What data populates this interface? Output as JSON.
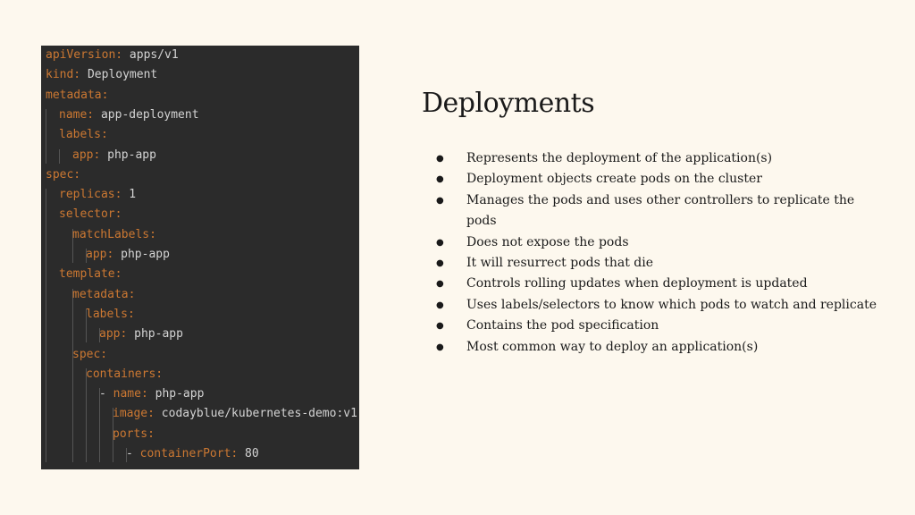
{
  "code": {
    "lines": [
      {
        "key": "apiVersion:",
        "val": " apps/v1"
      },
      {
        "key": "kind:",
        "val": " Deployment"
      },
      {
        "key": "metadata:",
        "val": ""
      },
      {
        "key": "name:",
        "val": " app-deployment"
      },
      {
        "key": "labels:",
        "val": ""
      },
      {
        "key": "app:",
        "val": " php-app"
      },
      {
        "key": "spec:",
        "val": ""
      },
      {
        "key": "replicas:",
        "val": " 1"
      },
      {
        "key": "selector:",
        "val": ""
      },
      {
        "key": "matchLabels:",
        "val": ""
      },
      {
        "key": "app:",
        "val": " php-app"
      },
      {
        "key": "template:",
        "val": ""
      },
      {
        "key": "metadata:",
        "val": ""
      },
      {
        "key": "labels:",
        "val": ""
      },
      {
        "key": "app:",
        "val": " php-app"
      },
      {
        "key": "spec:",
        "val": ""
      },
      {
        "key": "containers:",
        "val": ""
      },
      {
        "key": "name:",
        "val": " php-app",
        "prefix": "- "
      },
      {
        "key": "image:",
        "val": " codayblue/kubernetes-demo:v1"
      },
      {
        "key": "ports:",
        "val": ""
      },
      {
        "key": "containerPort:",
        "val": " 80",
        "prefix": "- "
      }
    ]
  },
  "title": "Deployments",
  "bullets": [
    "Represents the deployment of the application(s)",
    "Deployment objects create pods on the cluster",
    "Manages the pods and uses other controllers to replicate the pods",
    "Does not expose the pods",
    "It will resurrect pods that die",
    "Controls rolling updates when deployment is updated",
    "Uses labels/selectors to know which pods to watch and replicate",
    "Contains the pod specification",
    "Most common way to deploy an application(s)"
  ],
  "bullet_glyph": "●",
  "colors": {
    "background": "#fdf8ee",
    "code_background": "#2b2b2b",
    "yaml_key": "#cc7832",
    "yaml_value": "#d4d4d4"
  }
}
